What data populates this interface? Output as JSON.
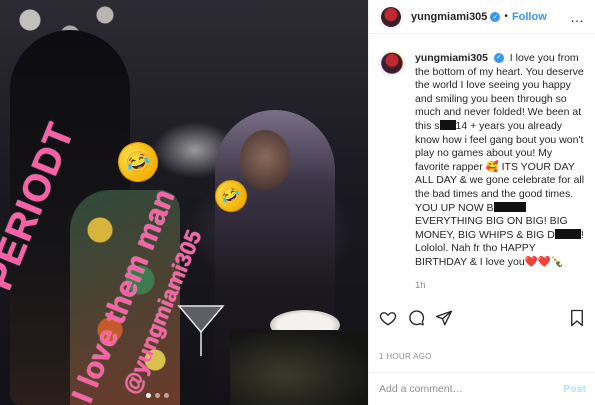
{
  "post": {
    "photo_overlay": {
      "periodt": "PERIODT",
      "love_line": "I love them man",
      "handle": "@yungmiami305"
    },
    "emojis": [
      "rolling-on-floor-laughing",
      "rolling-on-floor-laughing"
    ],
    "carousel_dots": 3
  },
  "header": {
    "username": "yungmiami305",
    "separator": "•",
    "follow_label": "Follow",
    "more_icon": "…"
  },
  "caption": {
    "username": "yungmiami305",
    "text_1": "I love you from the bottom of my heart. You deserve the world I love seeing you happy and smiling you been through so much and never folded! We been at this s",
    "text_2": "14 + years you already know how i feel gang bout you won't play no games about you! My favorite rapper 🥰 ITS YOUR DAY ALL DAY & we gone celebrate for all the bad times and the good times. YOU UP NOW B",
    "text_3": " EVERYTHING BIG ON BIG! BIG MONEY, BIG WHIPS & BIG D",
    "text_4": "! Lololol. Nah fr tho HAPPY BIRTHDAY & I love you",
    "hearts": "❤️❤️",
    "bottle": "🍾",
    "time": "1h"
  },
  "actions": {
    "like_icon": "heart-outline",
    "comment_icon": "comment-bubble",
    "share_icon": "paper-plane",
    "save_icon": "bookmark"
  },
  "timestamp": "1 HOUR AGO",
  "add_comment": {
    "placeholder": "Add a comment…",
    "post_label": "Post"
  },
  "colors": {
    "accent": "#3897f0",
    "story_text": "#ff5fa8",
    "post_disabled": "#b2dffc"
  }
}
